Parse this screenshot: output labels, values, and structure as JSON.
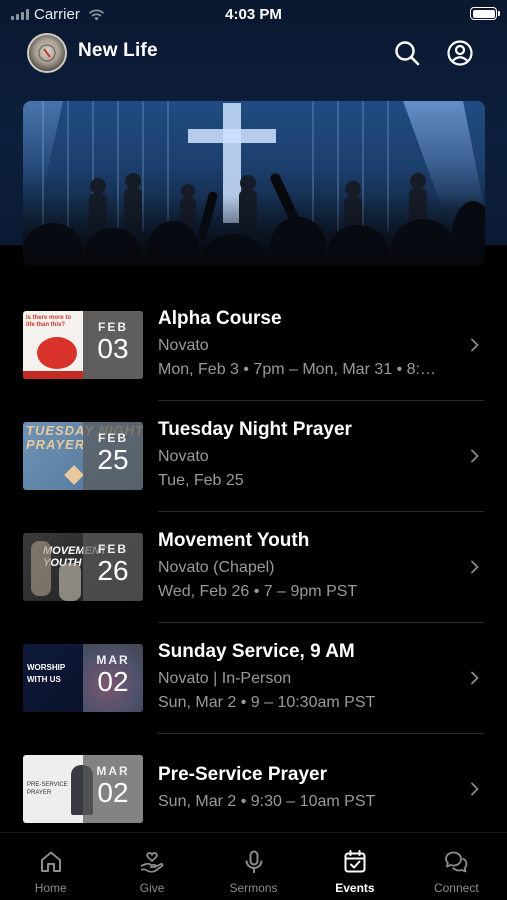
{
  "status_bar": {
    "carrier": "Carrier",
    "time": "4:03 PM"
  },
  "header": {
    "title": "New Life"
  },
  "events": [
    {
      "title": "Alpha Course",
      "month": "FEB",
      "day": "03",
      "lines": [
        "Novato",
        "Mon, Feb 3 • 7pm – Mon, Mar 31 • 8:…"
      ],
      "thumb_text": "Is there more to life than this?"
    },
    {
      "title": "Tuesday Night Prayer",
      "month": "FEB",
      "day": "25",
      "lines": [
        "Novato",
        "Tue, Feb 25"
      ],
      "thumb_text": "TUESDAY NIGHT PRAYER"
    },
    {
      "title": "Movement Youth",
      "month": "FEB",
      "day": "26",
      "lines": [
        "Novato (Chapel)",
        "Wed, Feb 26 • 7 – 9pm PST"
      ],
      "thumb_text": "MOVEMENT YOUTH"
    },
    {
      "title": "Sunday Service, 9 AM",
      "month": "MAR",
      "day": "02",
      "lines": [
        "Novato | In-Person",
        "Sun, Mar 2 • 9 – 10:30am PST"
      ],
      "thumb_text": "WORSHIP WITH US"
    },
    {
      "title": "Pre-Service Prayer",
      "month": "MAR",
      "day": "02",
      "lines": [
        "Sun, Mar 2 • 9:30 – 10am PST"
      ],
      "thumb_text": "PRE-SERVICE PRAYER"
    }
  ],
  "tabs": [
    {
      "label": "Home",
      "icon": "home-icon"
    },
    {
      "label": "Give",
      "icon": "give-icon"
    },
    {
      "label": "Sermons",
      "icon": "microphone-icon"
    },
    {
      "label": "Events",
      "icon": "calendar-icon",
      "active": true
    },
    {
      "label": "Connect",
      "icon": "chat-icon"
    }
  ]
}
